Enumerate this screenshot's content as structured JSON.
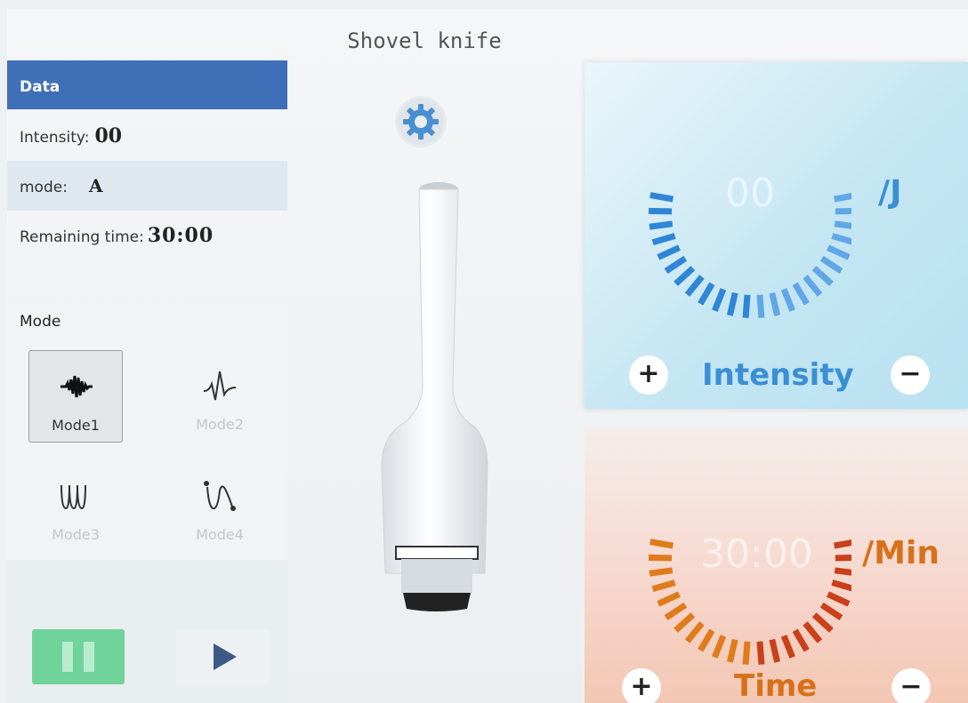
{
  "header": {
    "title": "Shovel knife"
  },
  "data_panel": {
    "heading": "Data",
    "intensity_label": "Intensity:",
    "intensity_value": "00",
    "mode_label": "mode:",
    "mode_value": "A",
    "remaining_label": "Remaining time:",
    "remaining_value": "30:00"
  },
  "mode_panel": {
    "title": "Mode",
    "modes": [
      {
        "label": "Mode1",
        "icon": "pulse-wave-icon",
        "selected": true
      },
      {
        "label": "Mode2",
        "icon": "spike-wave-icon",
        "selected": false
      },
      {
        "label": "Mode3",
        "icon": "sine-wave-icon",
        "selected": false
      },
      {
        "label": "Mode4",
        "icon": "curve-wave-icon",
        "selected": false
      }
    ]
  },
  "controls": {
    "pause_icon": "pause-icon",
    "play_icon": "play-icon"
  },
  "settings_icon": "gear-icon",
  "intensity": {
    "value": "00",
    "unit": "/J",
    "label": "Intensity",
    "plus": "+",
    "minus": "−",
    "color": "#3b8fd4"
  },
  "time": {
    "value": "30:00",
    "unit": "/Min",
    "label": "Time",
    "plus": "+",
    "minus": "−",
    "color": "#d7711b"
  },
  "colors": {
    "accent": "#3f6fb7",
    "pause": "#6fd39a",
    "play": "#3d5a85"
  }
}
